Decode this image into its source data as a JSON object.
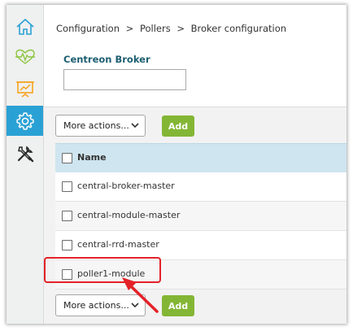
{
  "sidebar": {
    "items": [
      {
        "icon": "home-icon",
        "active": false
      },
      {
        "icon": "monitoring-icon",
        "active": false
      },
      {
        "icon": "reporting-icon",
        "active": false
      },
      {
        "icon": "gear-icon",
        "active": true
      },
      {
        "icon": "tools-icon",
        "active": false
      }
    ]
  },
  "breadcrumb": {
    "items": [
      "Configuration",
      "Pollers",
      "Broker configuration"
    ],
    "separator": ">"
  },
  "search": {
    "label": "Centreon Broker",
    "value": ""
  },
  "top_actions": {
    "select_value": "More actions...",
    "add_label": "Add"
  },
  "table": {
    "header": "Name",
    "rows": [
      {
        "name": "central-broker-master"
      },
      {
        "name": "central-module-master"
      },
      {
        "name": "central-rrd-master"
      },
      {
        "name": "poller1-module"
      }
    ]
  },
  "bottom_actions": {
    "select_value": "More actions...",
    "add_label": "Add"
  },
  "colors": {
    "accent": "#2aa1d4",
    "add_button": "#84b635",
    "header_bg": "#cfe5ef",
    "title": "#1d5e72",
    "annotation": "#e32127"
  }
}
